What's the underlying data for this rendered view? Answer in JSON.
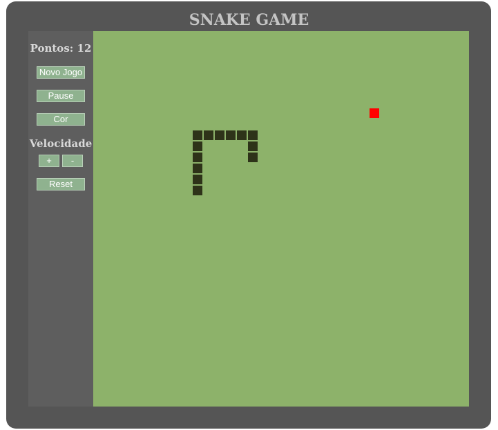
{
  "game": {
    "title": "SNAKE GAME",
    "score_text": "Pontos: 12",
    "speed_label": "Velocidade",
    "colors": {
      "board": "#8db26a",
      "snake": "#2e3319",
      "food": "#ff0000",
      "button": "#8fb28f",
      "frame": "#555555",
      "sidebar": "#5e5e5e"
    }
  },
  "controls": {
    "new_game": "Novo Jogo",
    "pause": "Pause",
    "color": "Cor",
    "speed_up": "+",
    "speed_down": "-",
    "reset": "Reset"
  },
  "board": {
    "cell_size": 16,
    "snake": [
      {
        "col": 14,
        "row": 11
      },
      {
        "col": 14,
        "row": 10
      },
      {
        "col": 14,
        "row": 9
      },
      {
        "col": 13,
        "row": 9
      },
      {
        "col": 12,
        "row": 9
      },
      {
        "col": 11,
        "row": 9
      },
      {
        "col": 10,
        "row": 9
      },
      {
        "col": 9,
        "row": 9
      },
      {
        "col": 9,
        "row": 10
      },
      {
        "col": 9,
        "row": 11
      },
      {
        "col": 9,
        "row": 12
      },
      {
        "col": 9,
        "row": 13
      },
      {
        "col": 9,
        "row": 14
      }
    ],
    "food": {
      "col": 25,
      "row": 7
    }
  }
}
